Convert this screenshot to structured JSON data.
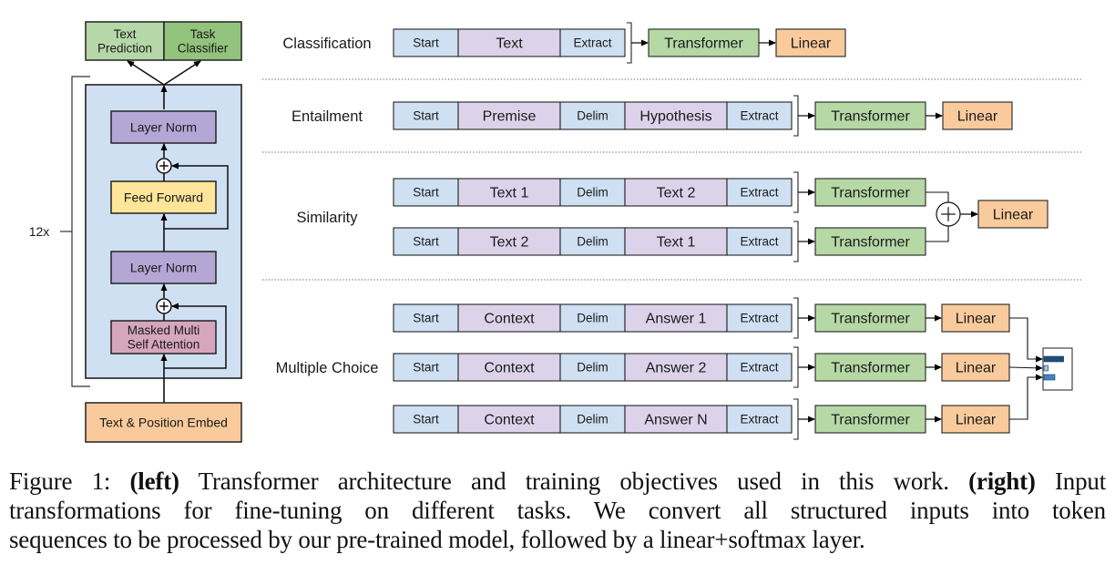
{
  "colors": {
    "token_blue": "#cfe0f3",
    "token_purple": "#dcd3ea",
    "transformer_green": "#b5d8a5",
    "linear_orange": "#f9cb9c",
    "block_bg": "#cfe0f3",
    "layer_norm": "#b4a7d6",
    "feed_forward": "#ffe599",
    "attention": "#d5a6bd",
    "embed": "#f9cb9c",
    "text_prediction": "#b6d7a8",
    "task_classifier": "#93c47d",
    "bar_dark": "#1f4e79",
    "bar_light": "#9fc5e8",
    "bar_mid": "#3d85c6"
  },
  "left": {
    "heads": [
      "Text\nPrediction",
      "Task\nClassifier"
    ],
    "layer_norm_top": "Layer Norm",
    "feed_forward": "Feed Forward",
    "layer_norm_bottom": "Layer Norm",
    "attention": "Masked Multi\nSelf Attention",
    "embed": "Text & Position Embed",
    "repeat": "12x"
  },
  "tasks": [
    {
      "label": "Classification",
      "rows": [
        [
          "Start",
          "Text",
          "Extract"
        ]
      ],
      "transformer": "Transformer",
      "linear": "Linear"
    },
    {
      "label": "Entailment",
      "rows": [
        [
          "Start",
          "Premise",
          "Delim",
          "Hypothesis",
          "Extract"
        ]
      ],
      "transformer": "Transformer",
      "linear": "Linear"
    },
    {
      "label": "Similarity",
      "rows": [
        [
          "Start",
          "Text 1",
          "Delim",
          "Text 2",
          "Extract"
        ],
        [
          "Start",
          "Text 2",
          "Delim",
          "Text 1",
          "Extract"
        ]
      ],
      "transformer": "Transformer",
      "linear": "Linear"
    },
    {
      "label": "Multiple Choice",
      "rows": [
        [
          "Start",
          "Context",
          "Delim",
          "Answer 1",
          "Extract"
        ],
        [
          "Start",
          "Context",
          "Delim",
          "Answer 2",
          "Extract"
        ],
        [
          "Start",
          "Context",
          "Delim",
          "Answer N",
          "Extract"
        ]
      ],
      "transformer": "Transformer",
      "linear": "Linear",
      "softmax_bars": [
        0.9,
        0.2,
        0.5
      ]
    }
  ],
  "caption": {
    "line1_a": "Figure 1: ",
    "line1_b": "(left)",
    "line1_c": " Transformer architecture and training objectives used in this work. ",
    "line1_d": "(right)",
    "line1_e": " Input",
    "line2": "transformations for fine-tuning on different tasks.  We convert all structured inputs into token",
    "line3": "sequences to be processed by our pre-trained model, followed by a linear+softmax layer."
  }
}
